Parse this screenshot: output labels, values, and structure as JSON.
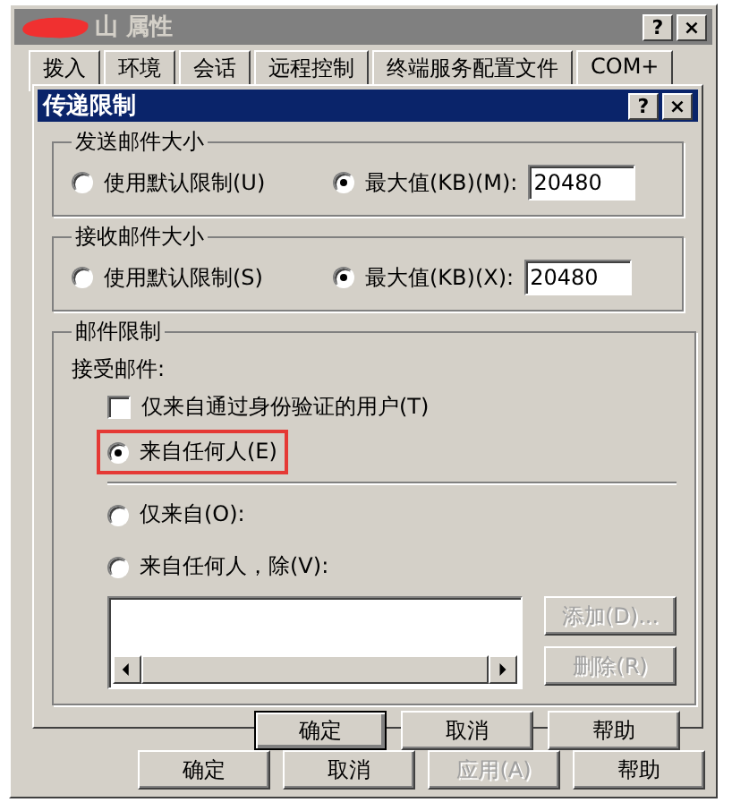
{
  "parent_window": {
    "title": "山 属性",
    "title_buttons": [
      "?",
      "×"
    ],
    "tabs": [
      {
        "label": "拨入"
      },
      {
        "label": "环境"
      },
      {
        "label": "会话"
      },
      {
        "label": "远程控制"
      },
      {
        "label": "终端服务配置文件"
      },
      {
        "label": "COM+"
      }
    ],
    "buttons": [
      {
        "label": "确定",
        "disabled": false
      },
      {
        "label": "取消",
        "disabled": false
      },
      {
        "label": "应用(A)",
        "disabled": true
      },
      {
        "label": "帮助",
        "disabled": false
      }
    ]
  },
  "dialog": {
    "title": "传递限制",
    "title_buttons": [
      "?",
      "×"
    ],
    "send_size": {
      "title": "发送邮件大小",
      "options": [
        {
          "label": "使用默认限制(U)",
          "selected": false
        },
        {
          "label": "最大值(KB)(M):",
          "selected": true
        }
      ],
      "value": "20480"
    },
    "receive_size": {
      "title": "接收邮件大小",
      "options": [
        {
          "label": "使用默认限制(S)",
          "selected": false
        },
        {
          "label": "最大值(KB)(X):",
          "selected": true
        }
      ],
      "value": "20480"
    },
    "message_restrictions": {
      "title": "邮件限制",
      "accept_label": "接受邮件:",
      "authenticated_only": {
        "label": "仅来自通过身份验证的用户(T)",
        "checked": false
      },
      "options": [
        {
          "label": "来自任何人(E)",
          "selected": true,
          "highlighted": true
        },
        {
          "label": "仅来自(O):",
          "selected": false,
          "highlighted": false
        },
        {
          "label": "来自任何人，除(V):",
          "selected": false,
          "highlighted": false
        }
      ],
      "buttons": [
        {
          "label": "添加(D)...",
          "disabled": true
        },
        {
          "label": "删除(R)",
          "disabled": true
        }
      ]
    },
    "buttons": [
      {
        "label": "确定",
        "default": true
      },
      {
        "label": "取消",
        "default": false
      },
      {
        "label": "帮助",
        "default": false
      }
    ]
  }
}
